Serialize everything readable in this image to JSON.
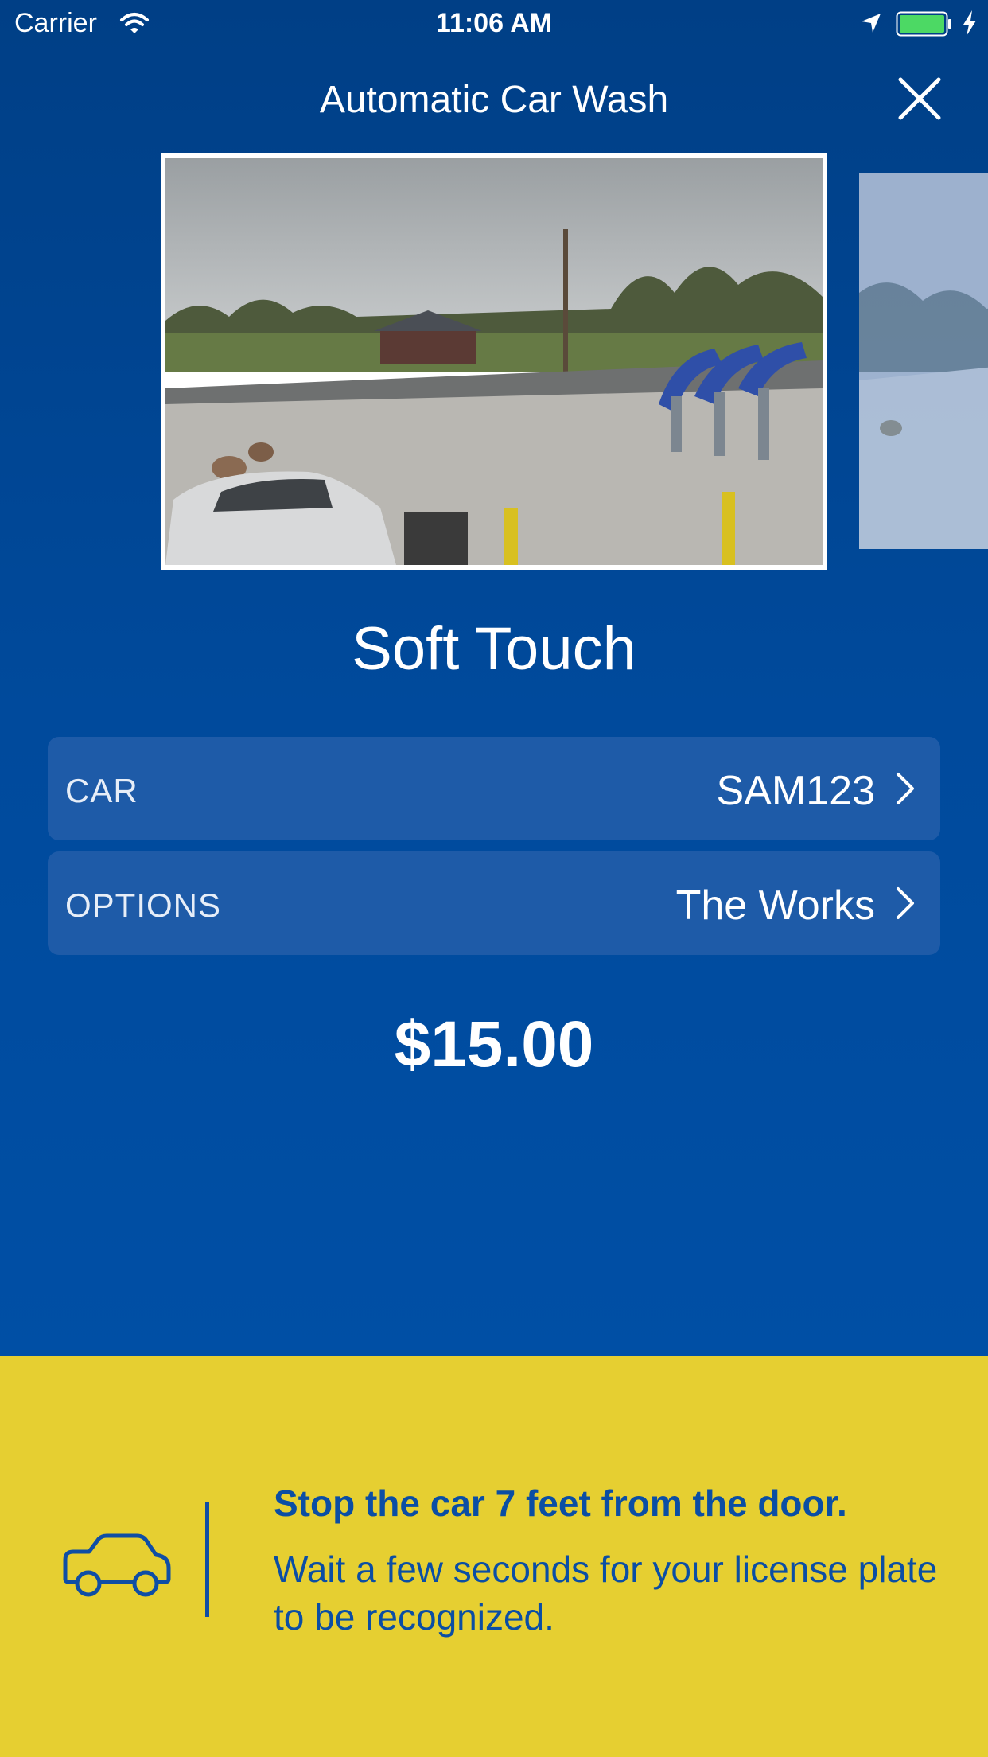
{
  "status_bar": {
    "carrier": "Carrier",
    "time": "11:06 AM"
  },
  "nav": {
    "title": "Automatic Car Wash"
  },
  "wash": {
    "name": "Soft Touch",
    "price": "$15.00"
  },
  "rows": {
    "car": {
      "label": "CAR",
      "value": "SAM123"
    },
    "options": {
      "label": "OPTIONS",
      "value": "The Works"
    }
  },
  "instructions": {
    "title": "Stop the car 7 feet from the door.",
    "body": "Wait a few seconds for your license plate to be recognized."
  },
  "colors": {
    "background_blue": "#004DA1",
    "row_blue": "#1E5BA8",
    "banner_yellow": "#E6CF31",
    "banner_text_blue": "#0B4EA4",
    "battery_green": "#4CD964"
  },
  "icons": [
    "wifi-icon",
    "location-arrow-icon",
    "battery-icon",
    "charging-icon",
    "close-icon",
    "chevron-right-icon",
    "car-icon"
  ]
}
